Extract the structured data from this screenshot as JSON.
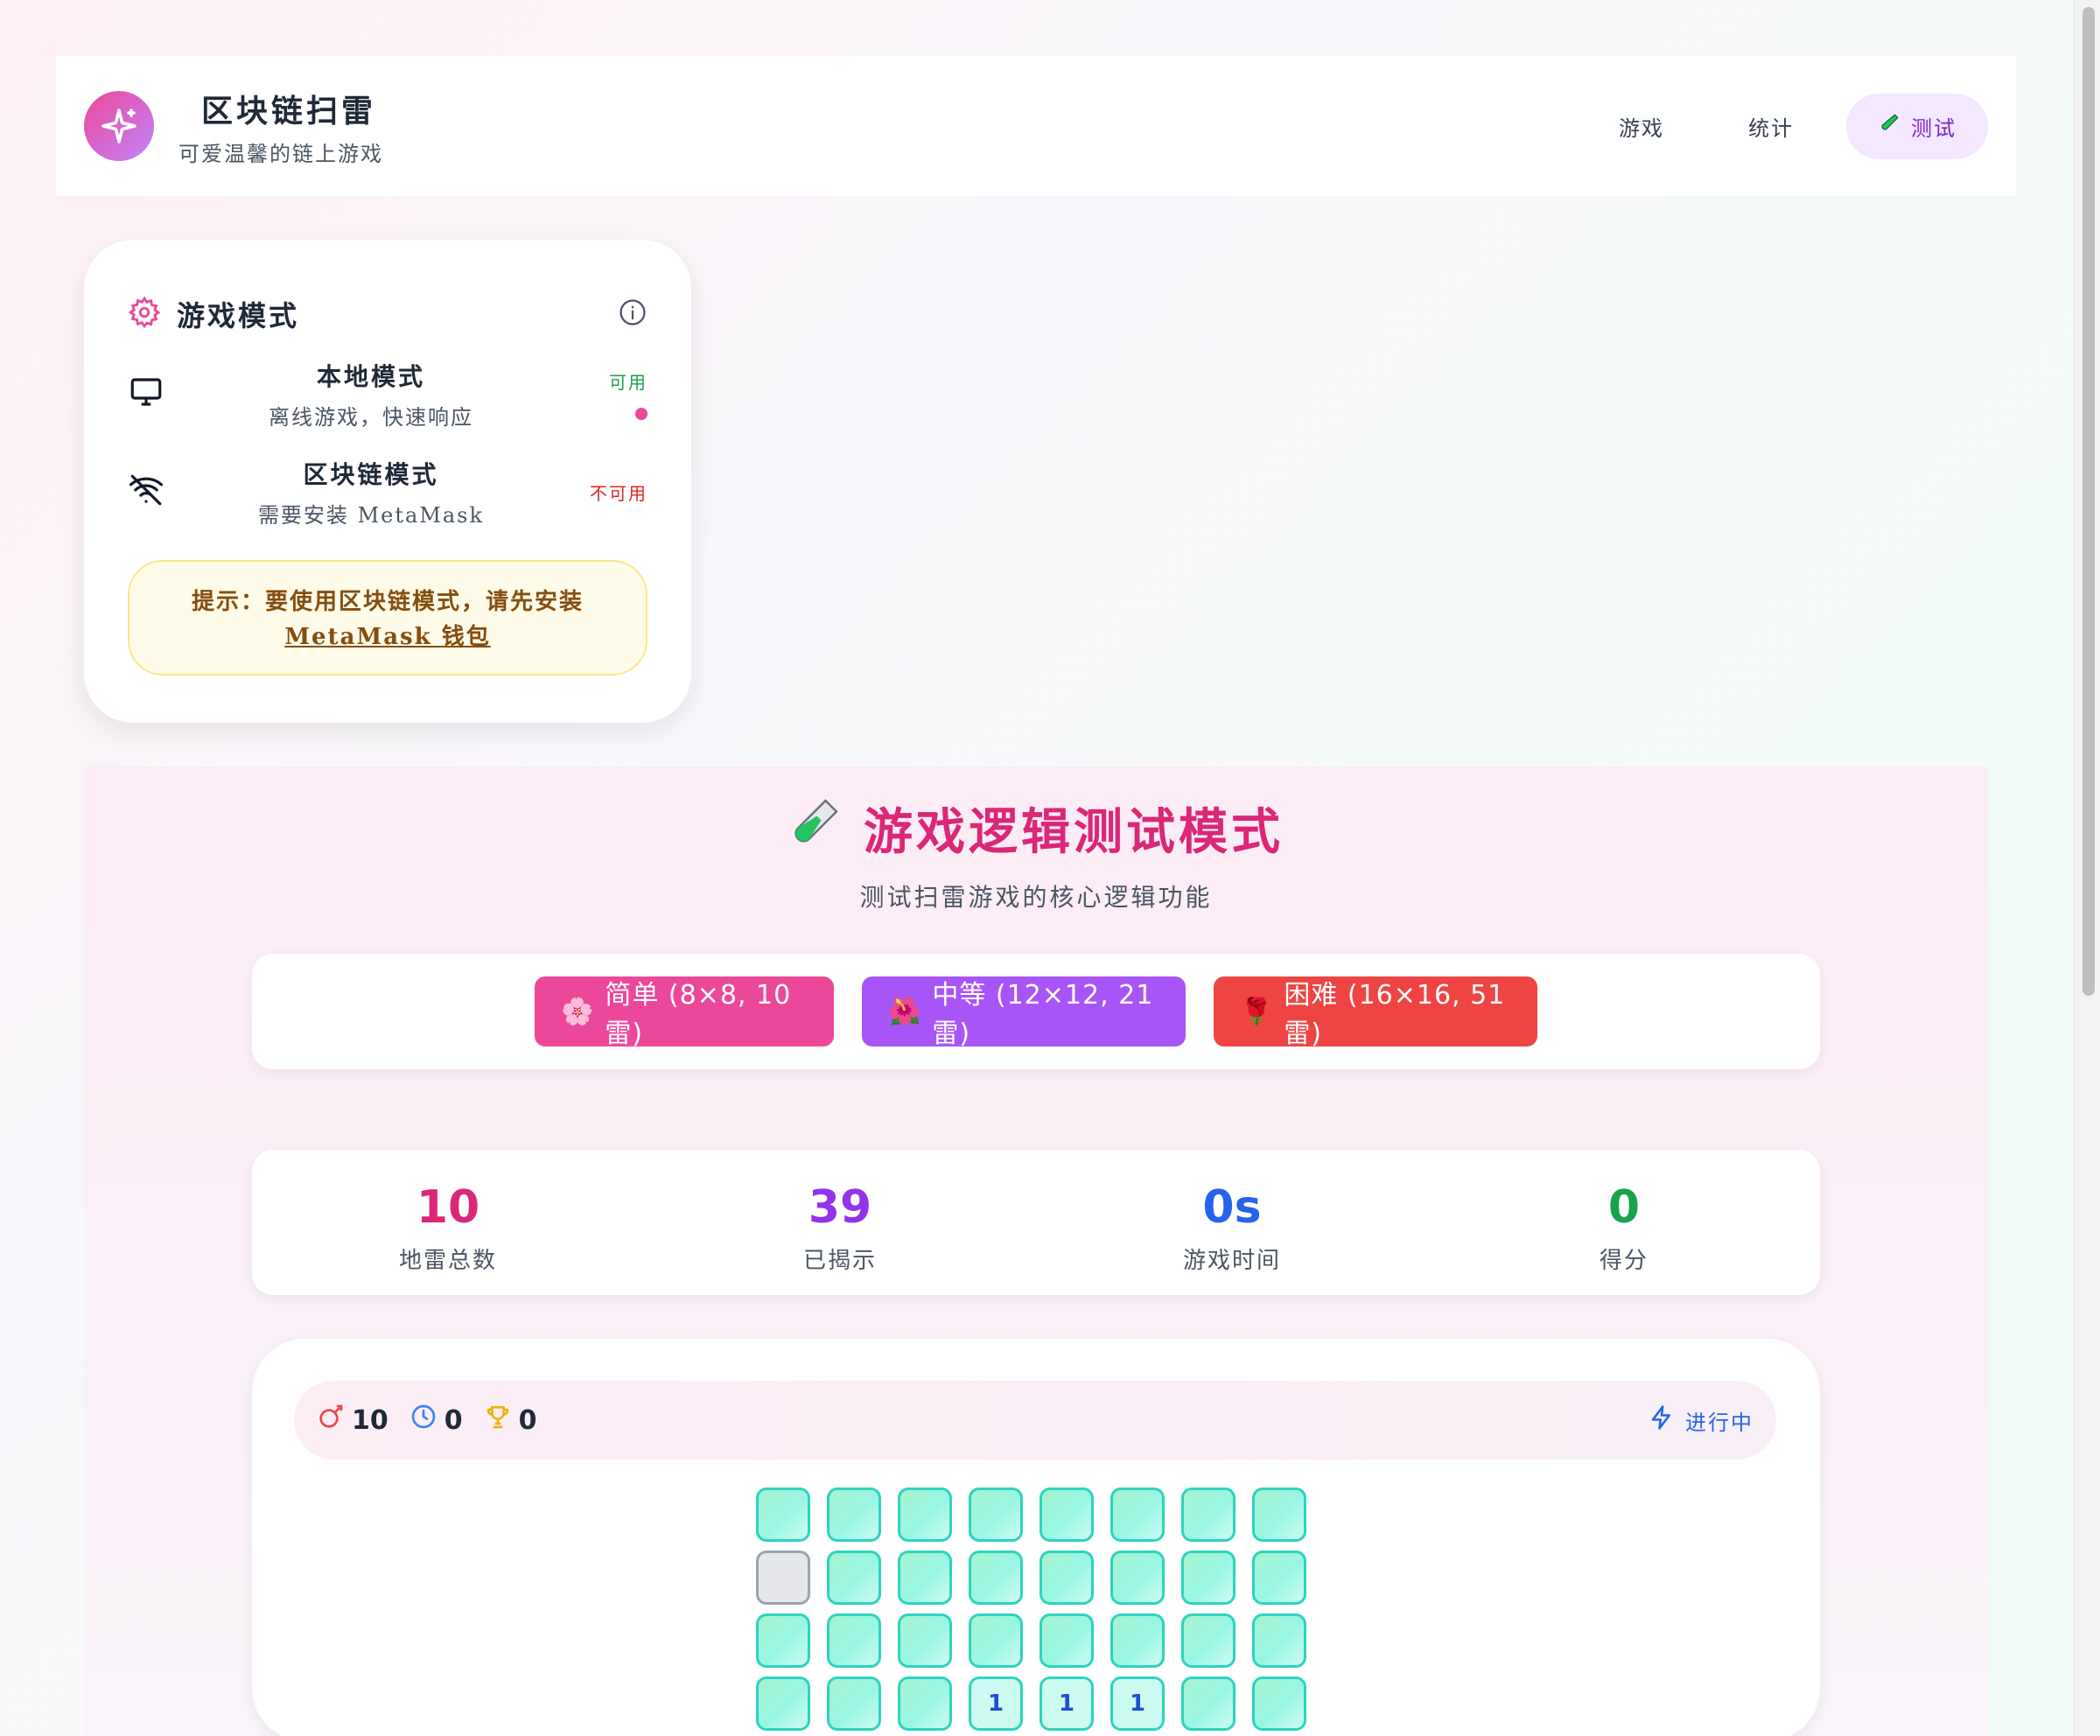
{
  "header": {
    "title": "区块链扫雷",
    "subtitle": "可爱温馨的链上游戏",
    "nav": {
      "game": "游戏",
      "stats": "统计",
      "test": "测试"
    }
  },
  "mode_card": {
    "title": "游戏模式",
    "local": {
      "name": "本地模式",
      "desc": "离线游戏，快速响应",
      "status": "可用"
    },
    "chain": {
      "name": "区块链模式",
      "desc": "需要安装 MetaMask",
      "status": "不可用"
    },
    "hint_text": "提示：要使用区块链模式，请先安装",
    "hint_link": "MetaMask 钱包"
  },
  "test": {
    "title": "游戏逻辑测试模式",
    "subtitle": "测试扫雷游戏的核心逻辑功能",
    "difficulties": {
      "easy": "简单 (8×8, 10雷)",
      "mid": "中等 (12×12, 21雷)",
      "hard": "困难 (16×16, 51雷)"
    },
    "stats": [
      {
        "value": "10",
        "label": "地雷总数",
        "color": "#db2777"
      },
      {
        "value": "39",
        "label": "已揭示",
        "color": "#9333ea"
      },
      {
        "value": "0s",
        "label": "游戏时间",
        "color": "#2563eb"
      },
      {
        "value": "0",
        "label": "得分",
        "color": "#16a34a"
      }
    ]
  },
  "board": {
    "mines": "10",
    "time": "0",
    "score": "0",
    "status": "进行中",
    "rows": [
      [
        "",
        "",
        "",
        "",
        "",
        "",
        "",
        ""
      ],
      [
        "E",
        "",
        "",
        "",
        "",
        "",
        "",
        ""
      ],
      [
        "",
        "",
        "",
        "",
        "",
        "",
        "",
        ""
      ],
      [
        "",
        "",
        "",
        "1",
        "1",
        "1",
        "",
        ""
      ]
    ]
  },
  "colors": {
    "accent": "#ec4899",
    "purple": "#a855f7",
    "red": "#ef4444",
    "teal": "#2dd4bf"
  }
}
